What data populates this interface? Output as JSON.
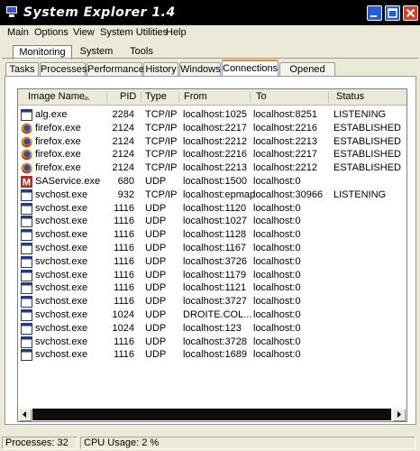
{
  "window": {
    "title": "System Explorer 1.4"
  },
  "menu": [
    "Main",
    "Options",
    "View",
    "System Utilities",
    "Help"
  ],
  "main_tabs": [
    "Monitoring",
    "System",
    "Tools"
  ],
  "sub_tabs": [
    "Tasks",
    "Processes",
    "Performance",
    "History",
    "Windows",
    "Connections",
    "Opened Files"
  ],
  "active_sub_tab": "Connections",
  "columns": {
    "name": "Image Name",
    "pid": "PID",
    "type": "Type",
    "from": "From",
    "to": "To",
    "status": "Status"
  },
  "rows": [
    {
      "icon": "window-icon",
      "name": "alg.exe",
      "pid": "2284",
      "type": "TCP/IP",
      "from": "localhost:1025",
      "to": "localhost:8251",
      "status": "LISTENING"
    },
    {
      "icon": "firefox-icon",
      "name": "firefox.exe",
      "pid": "2124",
      "type": "TCP/IP",
      "from": "localhost:2217",
      "to": "localhost:2216",
      "status": "ESTABLISHED"
    },
    {
      "icon": "firefox-icon",
      "name": "firefox.exe",
      "pid": "2124",
      "type": "TCP/IP",
      "from": "localhost:2212",
      "to": "localhost:2213",
      "status": "ESTABLISHED"
    },
    {
      "icon": "firefox-icon",
      "name": "firefox.exe",
      "pid": "2124",
      "type": "TCP/IP",
      "from": "localhost:2216",
      "to": "localhost:2217",
      "status": "ESTABLISHED"
    },
    {
      "icon": "firefox-icon",
      "name": "firefox.exe",
      "pid": "2124",
      "type": "TCP/IP",
      "from": "localhost:2213",
      "to": "localhost:2212",
      "status": "ESTABLISHED"
    },
    {
      "icon": "saservice-icon",
      "name": "SAService.exe",
      "pid": "680",
      "type": "UDP",
      "from": "localhost:1500",
      "to": "localhost:0",
      "status": ""
    },
    {
      "icon": "window-icon",
      "name": "svchost.exe",
      "pid": "932",
      "type": "TCP/IP",
      "from": "localhost:epmap",
      "to": "localhost:30966",
      "status": "LISTENING"
    },
    {
      "icon": "window-icon",
      "name": "svchost.exe",
      "pid": "1116",
      "type": "UDP",
      "from": "localhost:1120",
      "to": "localhost:0",
      "status": ""
    },
    {
      "icon": "window-icon",
      "name": "svchost.exe",
      "pid": "1116",
      "type": "UDP",
      "from": "localhost:1027",
      "to": "localhost:0",
      "status": ""
    },
    {
      "icon": "window-icon",
      "name": "svchost.exe",
      "pid": "1116",
      "type": "UDP",
      "from": "localhost:1128",
      "to": "localhost:0",
      "status": ""
    },
    {
      "icon": "window-icon",
      "name": "svchost.exe",
      "pid": "1116",
      "type": "UDP",
      "from": "localhost:1167",
      "to": "localhost:0",
      "status": ""
    },
    {
      "icon": "window-icon",
      "name": "svchost.exe",
      "pid": "1116",
      "type": "UDP",
      "from": "localhost:3726",
      "to": "localhost:0",
      "status": ""
    },
    {
      "icon": "window-icon",
      "name": "svchost.exe",
      "pid": "1116",
      "type": "UDP",
      "from": "localhost:1179",
      "to": "localhost:0",
      "status": ""
    },
    {
      "icon": "window-icon",
      "name": "svchost.exe",
      "pid": "1116",
      "type": "UDP",
      "from": "localhost:1121",
      "to": "localhost:0",
      "status": ""
    },
    {
      "icon": "window-icon",
      "name": "svchost.exe",
      "pid": "1116",
      "type": "UDP",
      "from": "localhost:3727",
      "to": "localhost:0",
      "status": ""
    },
    {
      "icon": "window-icon",
      "name": "svchost.exe",
      "pid": "1024",
      "type": "UDP",
      "from": "DROITE.COL...",
      "to": "localhost:0",
      "status": ""
    },
    {
      "icon": "window-icon",
      "name": "svchost.exe",
      "pid": "1024",
      "type": "UDP",
      "from": "localhost:123",
      "to": "localhost:0",
      "status": ""
    },
    {
      "icon": "window-icon",
      "name": "svchost.exe",
      "pid": "1116",
      "type": "UDP",
      "from": "localhost:3728",
      "to": "localhost:0",
      "status": ""
    },
    {
      "icon": "window-icon",
      "name": "svchost.exe",
      "pid": "1116",
      "type": "UDP",
      "from": "localhost:1689",
      "to": "localhost:0",
      "status": ""
    }
  ],
  "status": {
    "processes": "Processes: 32",
    "cpu": "CPU Usage: 2 %"
  },
  "colors": {
    "titlebar": "#000000",
    "panel": "#ece9d8",
    "active_tab_accent": "#e68b2c",
    "close_button": "#d8401f",
    "window_buttons": "#2a5bd7"
  }
}
